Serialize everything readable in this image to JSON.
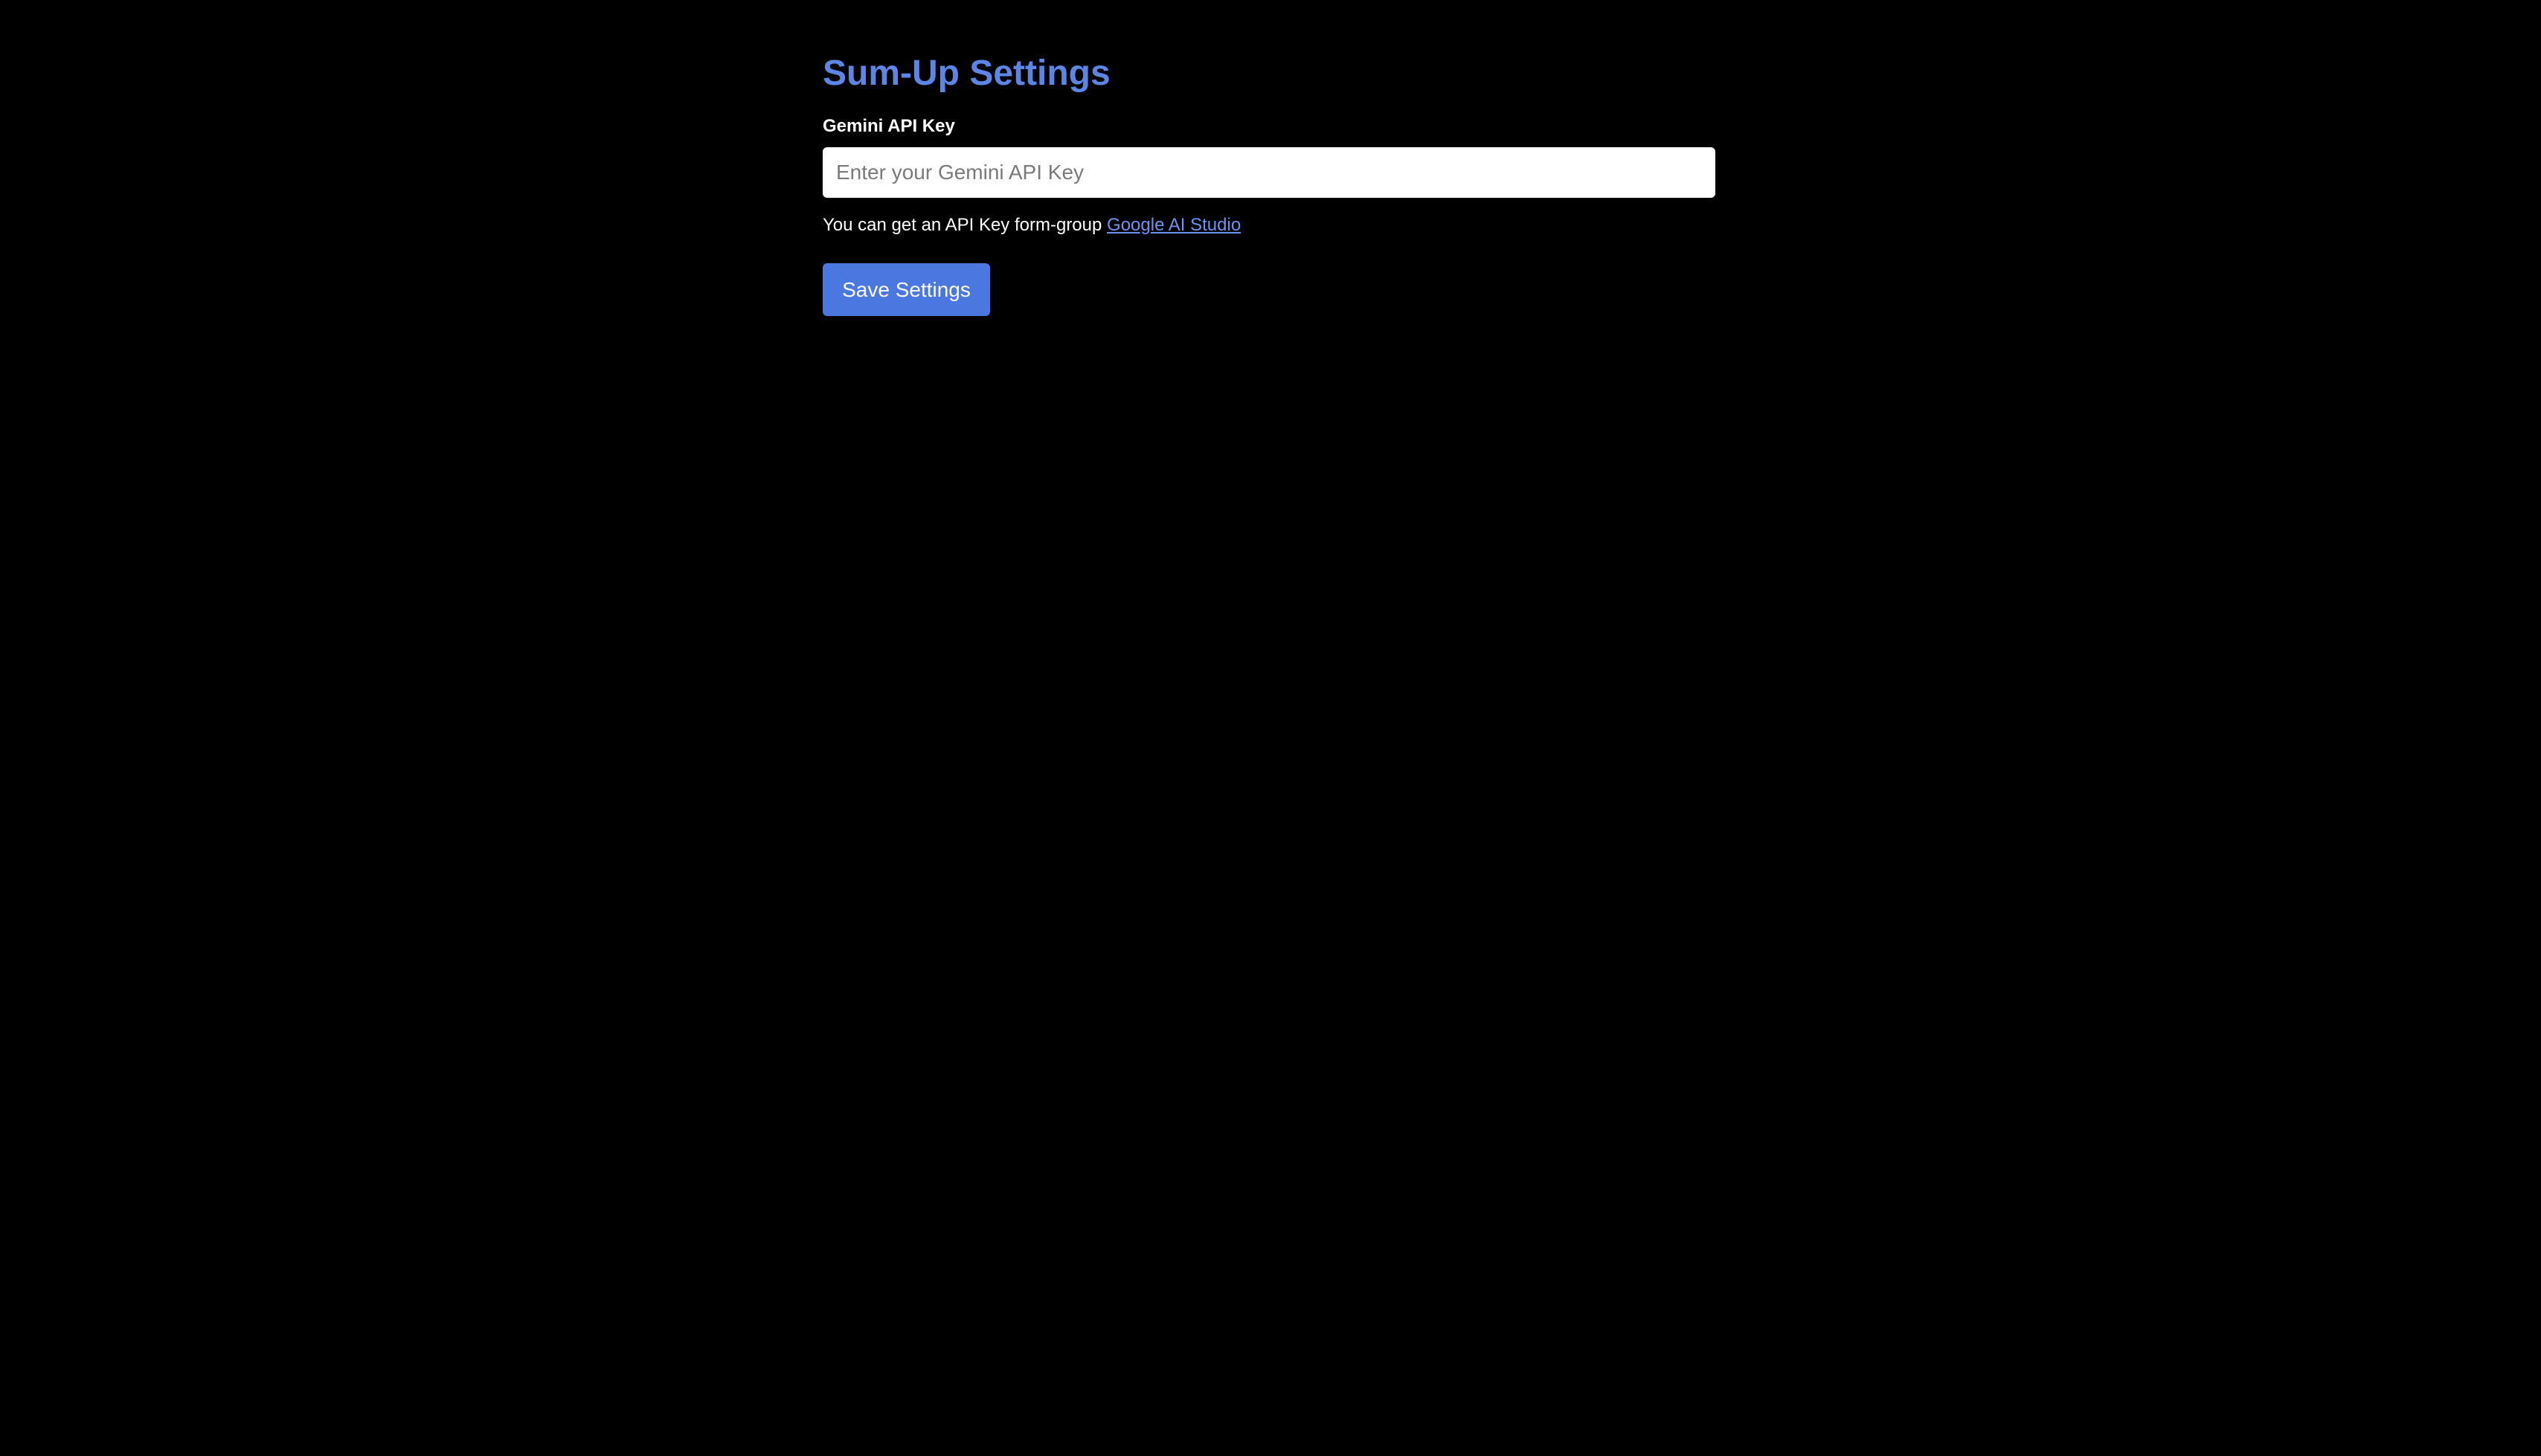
{
  "page": {
    "title": "Sum-Up Settings"
  },
  "form": {
    "api_key_label": "Gemini API Key",
    "api_key_placeholder": "Enter your Gemini API Key",
    "api_key_value": "",
    "help_text": "You can get an API Key form-group",
    "help_link_text": "Google AI Studio",
    "save_label": "Save Settings"
  },
  "colors": {
    "background": "#000000",
    "title": "#5b86e5",
    "link": "#6b93f0",
    "button": "#4a78e0"
  }
}
